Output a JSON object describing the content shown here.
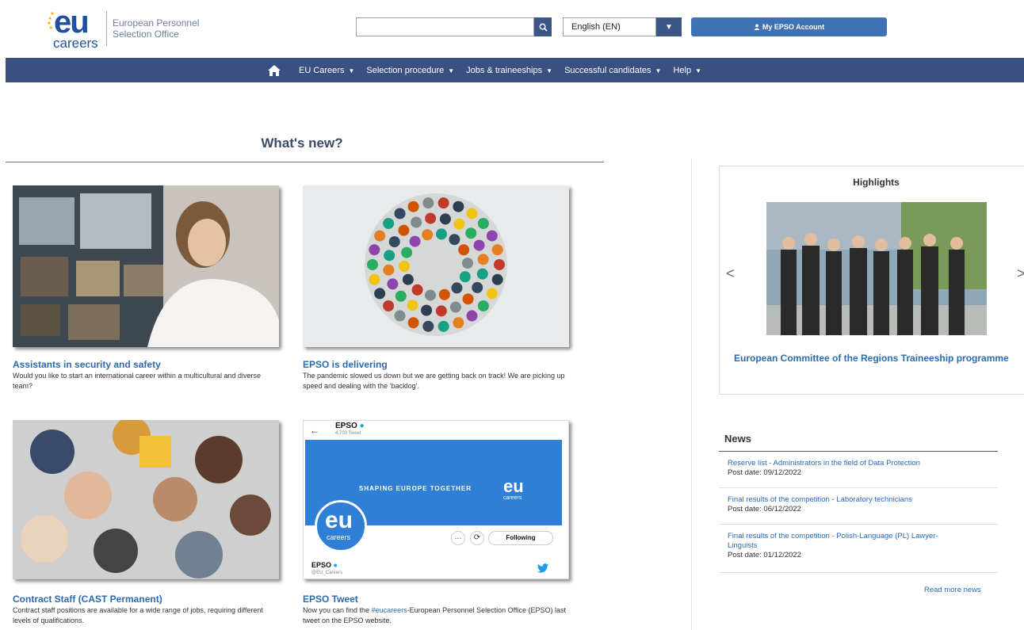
{
  "header": {
    "logo_eu": "eu",
    "logo_careers": "careers",
    "logo_org_line1": "European Personnel",
    "logo_org_line2": "Selection Office",
    "search_placeholder": "",
    "search_icon": "search-icon",
    "language": "English (EN)",
    "account_label": "My EPSO Account",
    "brand_color": "#3a5080",
    "accent_color": "#3f72b4"
  },
  "nav": {
    "home_icon": "home-icon",
    "items": [
      {
        "label": "EU Careers"
      },
      {
        "label": "Selection procedure"
      },
      {
        "label": "Jobs & traineeships"
      },
      {
        "label": "Successful candidates"
      },
      {
        "label": "Help"
      }
    ]
  },
  "main": {
    "heading": "What's new?",
    "cards": [
      {
        "title": "Assistants in security and safety",
        "desc": "Would you like to start an international career within a multicultural and diverse team?"
      },
      {
        "title": "EPSO is delivering",
        "desc": "The pandemic slowed us down but we are getting back on track! We are picking up speed and dealing with the ‘backlog’."
      },
      {
        "title": "Contract Staff (CAST Permanent)",
        "desc": "Contract staff positions are available for a wide range of jobs, requiring different levels of qualifications."
      },
      {
        "title": "EPSO Tweet",
        "desc_pre": "Now you can find the ",
        "desc_link": "#eucareers",
        "desc_post": "-European Personnel Selection Office (EPSO) last tweet on the EPSO website."
      }
    ],
    "tweet_card": {
      "account": "EPSO",
      "tweets": "4,700 Tweet",
      "banner_text": "SHAPING EUROPE TOGETHER",
      "banner_logo": "eu",
      "banner_logo_sub": "careers",
      "avatar_eu": "eu",
      "avatar_careers": "careers",
      "following": "Following",
      "handle_name": "EPSO",
      "handle": "@EU_Careers"
    }
  },
  "highlights": {
    "title": "Highlights",
    "prev": "<",
    "next": ">",
    "caption": "European Committee of the Regions Traineeship programme"
  },
  "news": {
    "title": "News",
    "items": [
      {
        "link": "Reserve list - Administrators in the field of Data Protection",
        "date": "Post date: 09/12/2022"
      },
      {
        "link": "Final results of the competition - Laboratory technicians",
        "date": "Post date: 06/12/2022"
      },
      {
        "link": "Final results of the competition - Polish-Language (PL) Lawyer-Linguists",
        "date": "Post date: 01/12/2022"
      }
    ],
    "read_more": "Read more news"
  }
}
